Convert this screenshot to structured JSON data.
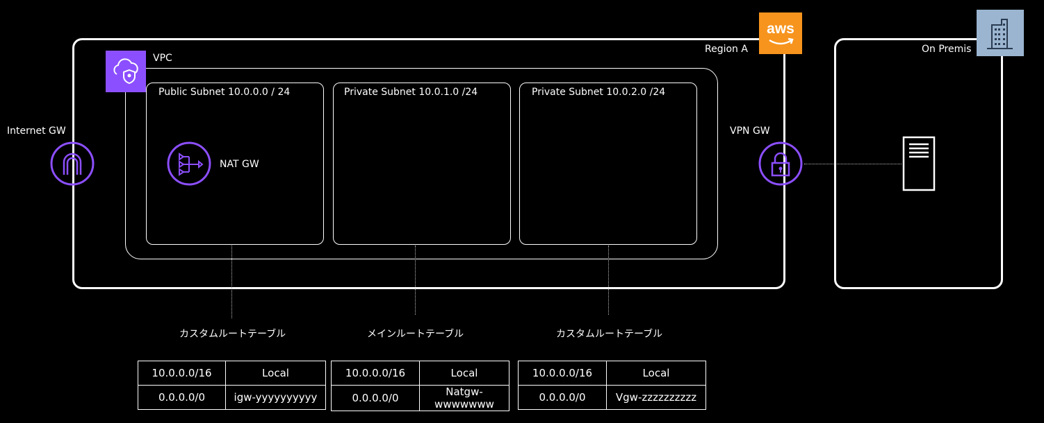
{
  "region": {
    "label": "Region A"
  },
  "aws_logo": {
    "text": "aws",
    "color": "#F7941D"
  },
  "vpc": {
    "label": "VPC",
    "icon_color": "#8C4FFF"
  },
  "subnets": [
    {
      "label": "Public Subnet 10.0.0.0 / 24"
    },
    {
      "label": "Private Subnet 10.0.1.0 /24"
    },
    {
      "label": "Private Subnet 10.0.2.0 /24"
    }
  ],
  "nat_gw": {
    "label": "NAT GW"
  },
  "internet_gw": {
    "label": "Internet  GW"
  },
  "vpn_gw": {
    "label": "VPN  GW"
  },
  "onprem": {
    "label": "On Premis",
    "icon_color": "#9BB5D0"
  },
  "route_tables": [
    {
      "caption": "カスタムルートテーブル",
      "rows": [
        [
          "10.0.0.0/16",
          "Local"
        ],
        [
          "0.0.0.0/0",
          "igw-yyyyyyyyyy"
        ]
      ]
    },
    {
      "caption": "メインルートテーブル",
      "rows": [
        [
          "10.0.0.0/16",
          "Local"
        ],
        [
          "0.0.0.0/0",
          "Natgw-wwwwwww"
        ]
      ]
    },
    {
      "caption": "カスタムルートテーブル",
      "rows": [
        [
          "10.0.0.0/16",
          "Local"
        ],
        [
          "0.0.0.0/0",
          "Vgw-zzzzzzzzzz"
        ]
      ]
    }
  ],
  "colors": {
    "accent_purple": "#8C4FFF",
    "line": "#FFFFFF"
  }
}
